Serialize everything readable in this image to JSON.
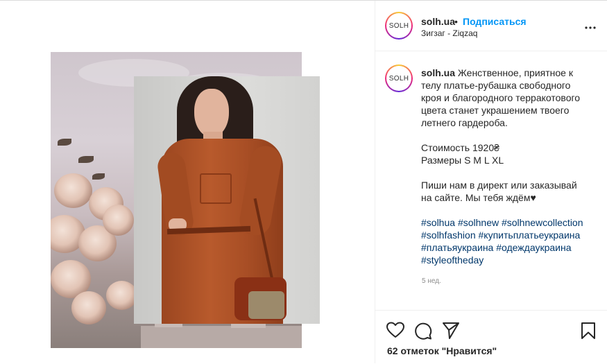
{
  "post": {
    "username": "solh.ua",
    "avatar_text": "SOLH",
    "separator": "•",
    "follow_label": "Подписаться",
    "location": "Зигзаг - Ziqzaq",
    "more_label": "•••",
    "caption": {
      "intro": "Женственное, приятное к телу платье-рубашка свободного кроя и благородного терракотового цвета станет украшением твоего летнего гардероба.",
      "price": "Стоимость 1920₴",
      "sizes": "Размеры S M L XL",
      "cta": "Пиши нам в директ или заказывай на сайте. Мы тебя ждём♥"
    },
    "hashtags": [
      "#solhua",
      "#solhnew",
      "#solhnewcollection",
      "#solhfashion",
      "#купитьплатьеукраина",
      "#платьяукраина",
      "#одеждаукраина",
      "#styleoftheday"
    ],
    "time_ago": "5 нед.",
    "likes_text": "62 отметок \"Нравится\""
  },
  "icons": {
    "like": "heart-icon",
    "comment": "comment-icon",
    "share": "paper-plane-icon",
    "save": "bookmark-icon",
    "more": "more-horizontal-icon"
  },
  "colors": {
    "follow": "#0095f6",
    "hashtag": "#00376b",
    "muted": "#8e8e8e",
    "dress": "#b85a2c"
  }
}
